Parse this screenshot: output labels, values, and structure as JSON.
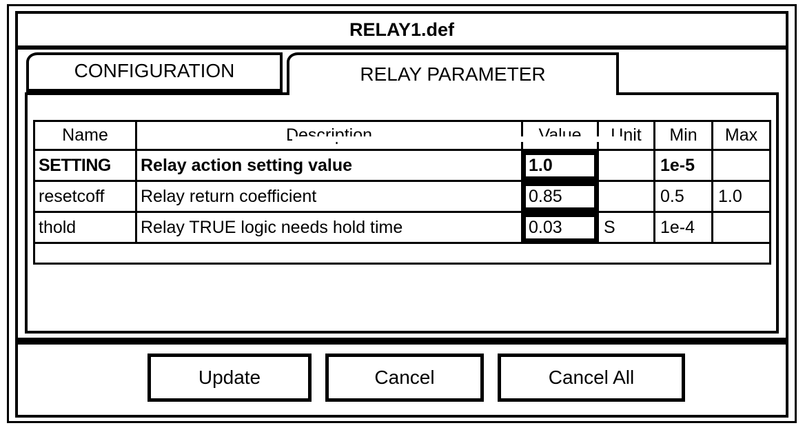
{
  "window": {
    "title": "RELAY1.def"
  },
  "tabs": [
    {
      "label": "CONFIGURATION",
      "active": false
    },
    {
      "label": "RELAY PARAMETER",
      "active": true
    }
  ],
  "table": {
    "headers": [
      "Name",
      "Description",
      "Value",
      "Unit",
      "Min",
      "Max"
    ],
    "rows": [
      {
        "name": "SETTING",
        "description": "Relay action setting value",
        "value": "1.0",
        "unit": "",
        "min": "1e-5",
        "max": "",
        "selected": true
      },
      {
        "name": "resetcoff",
        "description": "Relay return coefficient",
        "value": "0.85",
        "unit": "",
        "min": "0.5",
        "max": "1.0",
        "selected": false
      },
      {
        "name": "thold",
        "description": "Relay TRUE logic needs hold time",
        "value": "0.03",
        "unit": "S",
        "min": "1e-4",
        "max": "",
        "selected": false
      }
    ]
  },
  "buttons": {
    "update": "Update",
    "cancel": "Cancel",
    "cancel_all": "Cancel All"
  },
  "colors": {
    "foreground": "#000000",
    "background": "#ffffff"
  }
}
